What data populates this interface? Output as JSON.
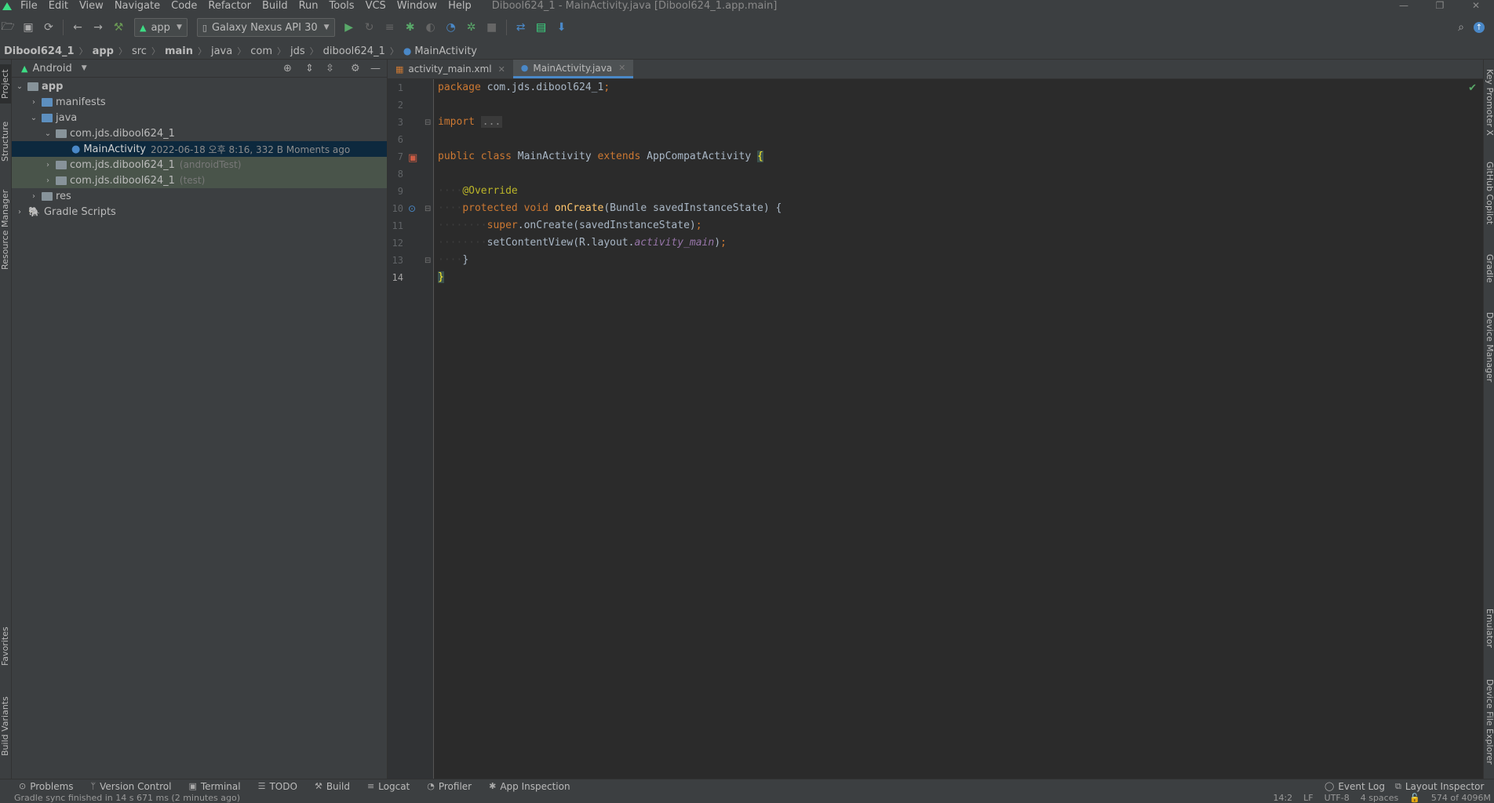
{
  "window": {
    "title": "Dibool624_1 - MainActivity.java [Dibool624_1.app.main]",
    "controls": [
      "—",
      "❐",
      "✕"
    ]
  },
  "menu": [
    "File",
    "Edit",
    "View",
    "Navigate",
    "Code",
    "Refactor",
    "Build",
    "Run",
    "Tools",
    "VCS",
    "Window",
    "Help"
  ],
  "toolbar": {
    "run_config": "app",
    "device": "Galaxy Nexus API 30"
  },
  "breadcrumb": [
    "Dibool624_1",
    "app",
    "src",
    "main",
    "java",
    "com",
    "jds",
    "dibool624_1",
    "MainActivity"
  ],
  "project_panel": {
    "view_mode": "Android",
    "tree": [
      {
        "label": "app",
        "hint": ""
      },
      {
        "label": "manifests",
        "hint": ""
      },
      {
        "label": "java",
        "hint": ""
      },
      {
        "label": "com.jds.dibool624_1",
        "hint": ""
      },
      {
        "label": "MainActivity",
        "hint": "2022-06-18 오후 8:16, 332 B Moments ago"
      },
      {
        "label": "com.jds.dibool624_1",
        "hint": "(androidTest)"
      },
      {
        "label": "com.jds.dibool624_1",
        "hint": "(test)"
      },
      {
        "label": "res",
        "hint": ""
      },
      {
        "label": "Gradle Scripts",
        "hint": ""
      }
    ]
  },
  "left_stripe": [
    "Project",
    "Structure",
    "Resource Manager",
    "Favorites",
    "Build Variants"
  ],
  "right_stripe": [
    "Key Promoter X",
    "GitHub Copilot",
    "Gradle",
    "Device Manager",
    "Emulator",
    "Device File Explorer"
  ],
  "editor": {
    "tabs": [
      {
        "label": "activity_main.xml",
        "active": false
      },
      {
        "label": "MainActivity.java",
        "active": true
      }
    ],
    "line_numbers": [
      "1",
      "2",
      "3",
      "6",
      "7",
      "8",
      "9",
      "10",
      "11",
      "12",
      "13",
      "14"
    ],
    "code": {
      "l1_kw": "package",
      "l1_rest": " com.jds.dibool624_1",
      "l1_semi": ";",
      "l3_kw": "import",
      "l3_fold": "...",
      "l7_kw1": "public",
      "l7_kw2": "class",
      "l7_name": "MainActivity",
      "l7_kw3": "extends",
      "l7_parent": "AppCompatActivity",
      "l7_brace": "{",
      "l9_ann": "@Override",
      "l10_kw1": "protected",
      "l10_kw2": "void",
      "l10_fn": "onCreate",
      "l10_rest": "(Bundle savedInstanceState) {",
      "l11_kw": "super",
      "l11_rest": ".onCreate(savedInstanceState)",
      "l11_semi": ";",
      "l12_a": "setContentView(R.layout.",
      "l12_it": "activity_main",
      "l12_b": ")",
      "l12_semi": ";",
      "l13": "}",
      "l14": "}"
    }
  },
  "bottom_tools": [
    "Problems",
    "Version Control",
    "Terminal",
    "TODO",
    "Build",
    "Logcat",
    "Profiler",
    "App Inspection"
  ],
  "bottom_tools_right": [
    "Event Log",
    "Layout Inspector"
  ],
  "status": {
    "message": "Gradle sync finished in 14 s 671 ms (2 minutes ago)",
    "position": "14:2",
    "line_sep": "LF",
    "encoding": "UTF-8",
    "indent": "4 spaces",
    "memory": "574 of 4096M"
  },
  "colors": {
    "accent": "#4a88c7",
    "selection": "#0d293e",
    "keyword": "#cc7832",
    "annotation": "#bbb529",
    "function": "#ffc66d"
  }
}
